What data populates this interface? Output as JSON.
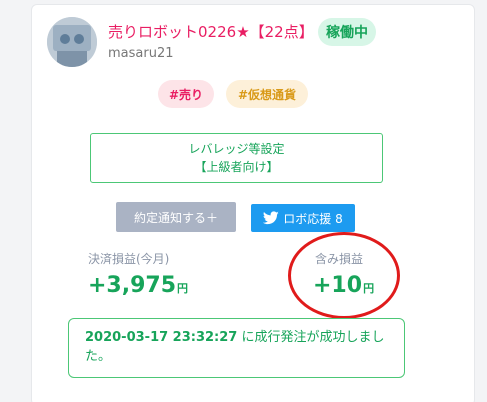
{
  "bot": {
    "title": "売りロボット0226",
    "star": "★",
    "points": "【22点】",
    "status": "稼働中",
    "username": "masaru21"
  },
  "tags": [
    "#売り",
    "#仮想通貨"
  ],
  "leverage": {
    "line1": "レバレッジ等設定",
    "line2": "【上級者向け】"
  },
  "buttons": {
    "notify": "約定通知する＋",
    "support": "ロボ応援 8"
  },
  "stats": {
    "realized_label": "決済損益(今月)",
    "realized_value": "+3,975",
    "unrealized_label": "含み損益",
    "unrealized_value": "+10",
    "unit": "円"
  },
  "alert": {
    "timestamp": "2020-03-17 23:32:27",
    "message": " に成行発注が成功しました。"
  },
  "colors": {
    "green": "#17a45a",
    "pink": "#e91e63",
    "twitter": "#1d9bf0",
    "annotation": "#e01b1b"
  }
}
